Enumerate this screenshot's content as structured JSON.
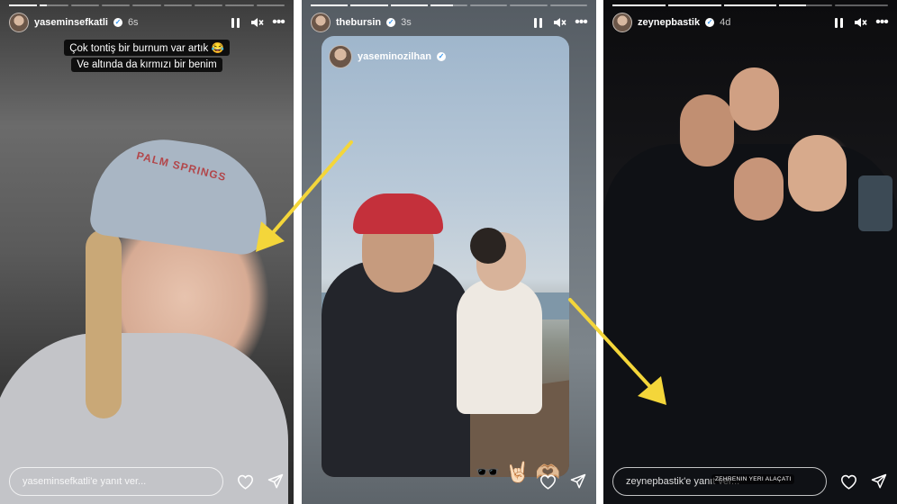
{
  "stories": [
    {
      "username": "yaseminsefkatli",
      "time": "6s",
      "caption_lines": [
        "Çok tontiş bir burnum var artık 😂",
        "Ve altında da kırmızı bir benim"
      ],
      "cap_text": "PALM SPRINGS",
      "reply_placeholder": "yaseminsefkatli'e yanıt ver...",
      "progress": [
        1,
        0.25,
        0,
        0,
        0,
        0,
        0,
        0,
        0
      ]
    },
    {
      "username": "thebursin",
      "time": "3s",
      "repost_username": "yaseminozilhan",
      "emojis": [
        "🕶️",
        "🤘🏻",
        "🫶🏼"
      ],
      "progress": [
        1,
        1,
        1,
        0.6,
        0,
        0,
        0
      ]
    },
    {
      "username": "zeynepbastik",
      "time": "4d",
      "reply_placeholder": "zeynepbastik'e yanıt ver...",
      "location_sticker": "ZEHRENIN YERI ALAÇATI",
      "progress": [
        1,
        1,
        1,
        0.5,
        0
      ]
    }
  ],
  "icons": {
    "pause": "pause-icon",
    "mute": "speaker-muted-icon",
    "more": "more-dots-icon",
    "like": "heart-icon",
    "send": "send-icon"
  },
  "colors": {
    "arrow": "#f4d63a",
    "verified": "#3897f0"
  }
}
